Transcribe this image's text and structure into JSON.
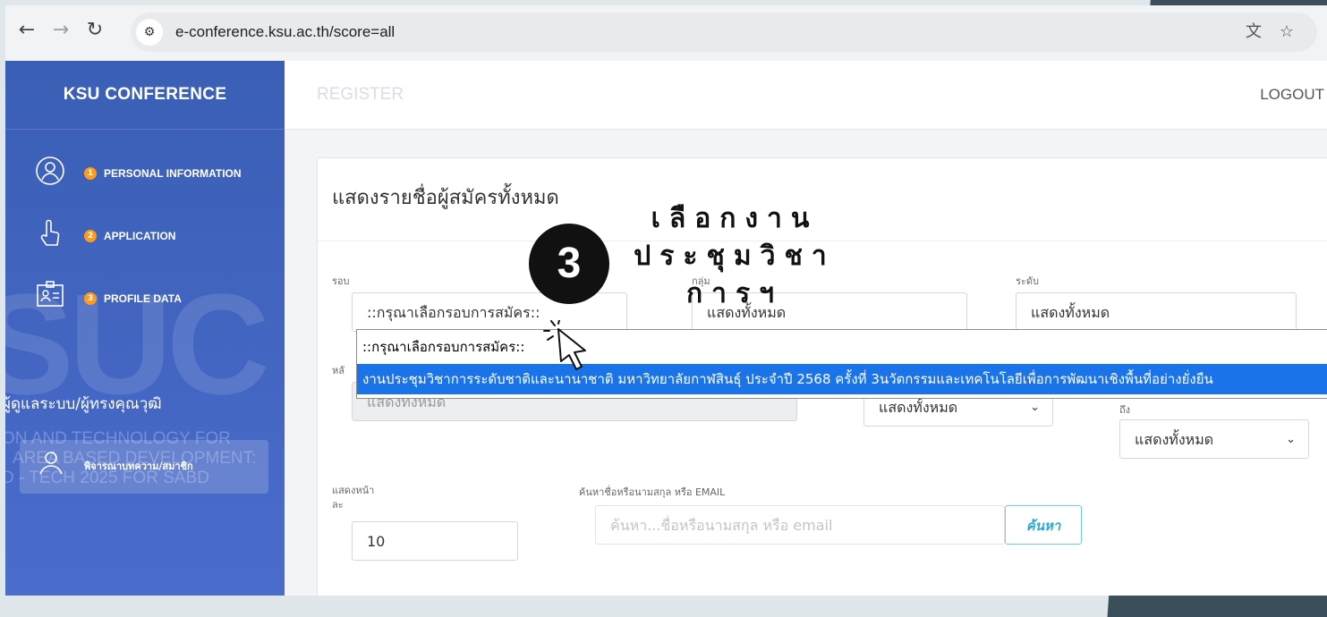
{
  "browser": {
    "back_icon": "arrow-left-icon",
    "forward_icon": "arrow-right-icon",
    "reload_icon": "reload-icon",
    "url": "e-conference.ksu.ac.th/score=all",
    "translate_icon": "translate-icon",
    "star_icon": "star-icon"
  },
  "sidebar": {
    "title": "KSU CONFERENCE",
    "items": [
      {
        "num": "1",
        "label": "PERSONAL INFORMATION",
        "icon": "user-icon"
      },
      {
        "num": "2",
        "label": "APPLICATION",
        "icon": "pointer-hand-icon"
      },
      {
        "num": "3",
        "label": "PROFILE DATA",
        "icon": "id-card-icon"
      }
    ],
    "watermark_text": "SUC",
    "watermark_lines": [
      "ON AND TECHNOLOGY FOR",
      "AREA BASED DEVELOPMENT:",
      "D - TECH 2025 FOR SABD"
    ],
    "role_text": "ผู้ดูแลระบบ/ผู้ทรงคุณวุฒิ",
    "role_button": "พิจารณาบทความ/สมาชิก"
  },
  "topbar": {
    "register": "REGISTER",
    "logout": "LOGOUT"
  },
  "card": {
    "title": "แสดงรายชื่อผู้สมัครทั้งหมด",
    "round_label": "รอบ",
    "round_value": "::กรุณาเลือกรอบการสมัคร::",
    "group_label": "กลุ่ม",
    "group_value": "แสดงทั้งหมด",
    "level_label": "ระดับ",
    "level_value": "แสดงทั้งหมด",
    "row2_label_1": "หลั",
    "row2_value_1": "แสดงทั้งหมด",
    "row2_value_2": "แสดงทั้งหมด",
    "row2_label_3": "ถึง",
    "row2_value_3": "แสดงทั้งหมด",
    "per_page_label_1": "แสดงหน้า",
    "per_page_label_2": "ละ",
    "per_page_value": "10",
    "search_label": "ค้นหาชื่อหรือนามสกุล หรือ EMAIL",
    "search_placeholder": "ค้นหา...ชื่อหรือนามสกุล หรือ email",
    "search_button": "ค้นหา"
  },
  "dropdown": {
    "options": [
      "::กรุณาเลือกรอบการสมัคร::",
      "งานประชุมวิชาการระดับชาติและนานาชาติ มหาวิทยาลัยกาฬสินธุ์ ประจำปี 2568 ครั้งที่ 3นวัตกรรมและเทคโนโลยีเพื่อการพัฒนาเชิงพื้นที่อย่างยั่งยืน"
    ],
    "selected_index": 1
  },
  "tutorial": {
    "step_number": "3",
    "instruction_lines": [
      "เลือกงาน",
      "ประชุมวิชา",
      "การฯ"
    ],
    "cursor_icon": "mouse-pointer-icon"
  },
  "colors": {
    "sidebar": "#4466c3",
    "badge": "#ff9b1a",
    "selected_option": "#1a73e8",
    "search_button_text": "#2aa9d9"
  }
}
